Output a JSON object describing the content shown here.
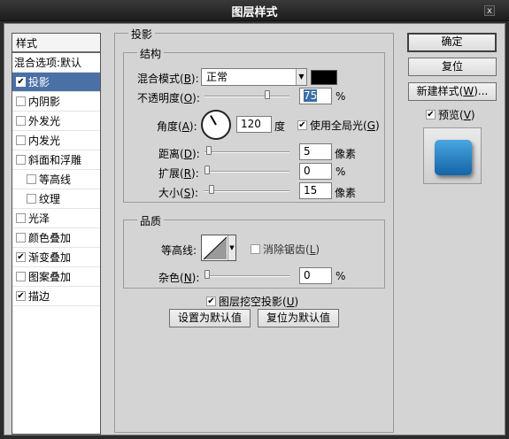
{
  "window": {
    "title": "图层样式",
    "close_glyph": "x"
  },
  "styles_panel": {
    "header": "样式",
    "items": [
      {
        "label": "混合选项:默认",
        "has_checkbox": false,
        "checked": false,
        "selected": false,
        "indent": 0
      },
      {
        "label": "投影",
        "has_checkbox": true,
        "checked": true,
        "selected": true,
        "indent": 0
      },
      {
        "label": "内阴影",
        "has_checkbox": true,
        "checked": false,
        "selected": false,
        "indent": 0
      },
      {
        "label": "外发光",
        "has_checkbox": true,
        "checked": false,
        "selected": false,
        "indent": 0
      },
      {
        "label": "内发光",
        "has_checkbox": true,
        "checked": false,
        "selected": false,
        "indent": 0
      },
      {
        "label": "斜面和浮雕",
        "has_checkbox": true,
        "checked": false,
        "selected": false,
        "indent": 0
      },
      {
        "label": "等高线",
        "has_checkbox": true,
        "checked": false,
        "selected": false,
        "indent": 1
      },
      {
        "label": "纹理",
        "has_checkbox": true,
        "checked": false,
        "selected": false,
        "indent": 1
      },
      {
        "label": "光泽",
        "has_checkbox": true,
        "checked": false,
        "selected": false,
        "indent": 0
      },
      {
        "label": "颜色叠加",
        "has_checkbox": true,
        "checked": false,
        "selected": false,
        "indent": 0
      },
      {
        "label": "渐变叠加",
        "has_checkbox": true,
        "checked": true,
        "selected": false,
        "indent": 0
      },
      {
        "label": "图案叠加",
        "has_checkbox": true,
        "checked": false,
        "selected": false,
        "indent": 0
      },
      {
        "label": "描边",
        "has_checkbox": true,
        "checked": true,
        "selected": false,
        "indent": 0
      }
    ]
  },
  "drop_shadow": {
    "section_title": "投影",
    "structure": {
      "title": "结构",
      "blend_mode_label": "混合模式(",
      "blend_mode_key": "B",
      "blend_mode_end": "):",
      "blend_mode_value": "正常",
      "shadow_color": "#000000",
      "opacity_label": "不透明度(",
      "opacity_key": "O",
      "opacity_end": "):",
      "opacity_value": "75",
      "opacity_fraction": 0.75,
      "percent": "%",
      "angle_label": "角度(",
      "angle_key": "A",
      "angle_end": "):",
      "angle_value": "120",
      "angle_unit": "度",
      "global_light_label": "使用全局光(",
      "global_light_key": "G",
      "global_light_end": ")",
      "global_light_checked": true,
      "distance_label": "距离(",
      "distance_key": "D",
      "distance_end": "):",
      "distance_value": "5",
      "distance_fraction": 0.02,
      "spread_label": "扩展(",
      "spread_key": "R",
      "spread_end": "):",
      "spread_value": "0",
      "spread_fraction": 0.0,
      "size_label": "大小(",
      "size_key": "S",
      "size_end": "):",
      "size_value": "15",
      "size_fraction": 0.06,
      "pixel_unit": "像素"
    },
    "quality": {
      "title": "品质",
      "contour_label": "等高线:",
      "antialias_label": "消除锯齿(",
      "antialias_key": "L",
      "antialias_end": ")",
      "antialias_checked": false,
      "noise_label": "杂色(",
      "noise_key": "N",
      "noise_end": "):",
      "noise_value": "0",
      "noise_fraction": 0.0
    },
    "knockout_label": "图层挖空投影(",
    "knockout_key": "U",
    "knockout_end": ")",
    "knockout_checked": true,
    "make_default_label": "设置为默认值",
    "reset_default_label": "复位为默认值"
  },
  "actions": {
    "ok_label": "确定",
    "reset_label": "复位",
    "new_style_label": "新建样式(",
    "new_style_key": "W",
    "new_style_end": ")...",
    "preview_label": "预览(",
    "preview_key": "V",
    "preview_end": ")",
    "preview_checked": true
  },
  "colors": {
    "selection": "#4a70a6",
    "preview_fill": "#2a82c8"
  }
}
